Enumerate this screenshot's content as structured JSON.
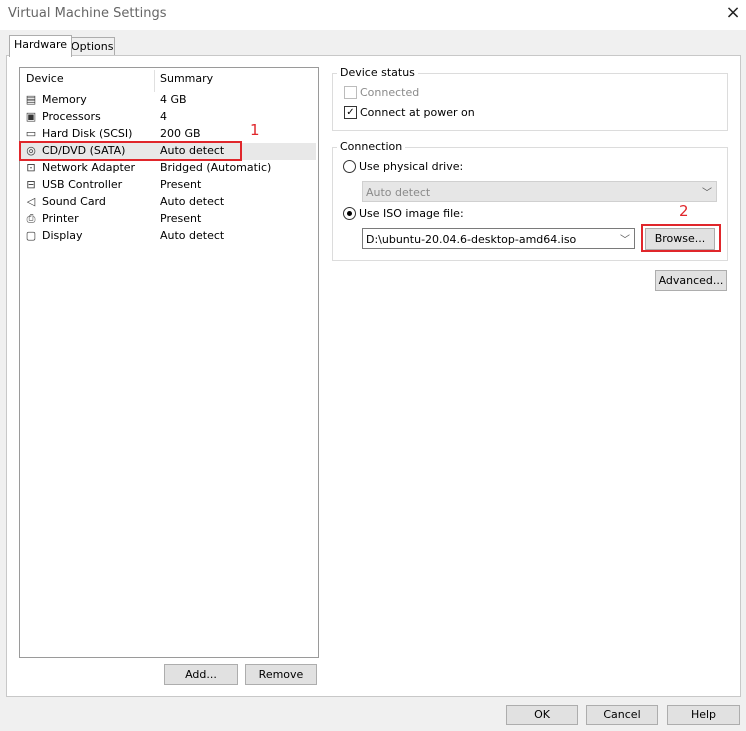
{
  "window": {
    "title": "Virtual Machine Settings",
    "close_icon": "×"
  },
  "tabs": [
    {
      "label": "Hardware",
      "active": true
    },
    {
      "label": "Options",
      "active": false
    }
  ],
  "device_list": {
    "headers": {
      "device": "Device",
      "summary": "Summary"
    },
    "rows": [
      {
        "name": "Memory",
        "summary": "4 GB",
        "icon": "memory-icon"
      },
      {
        "name": "Processors",
        "summary": "4",
        "icon": "processor-icon"
      },
      {
        "name": "Hard Disk (SCSI)",
        "summary": "200 GB",
        "icon": "hard-disk-icon"
      },
      {
        "name": "CD/DVD (SATA)",
        "summary": "Auto detect",
        "icon": "cd-dvd-icon"
      },
      {
        "name": "Network Adapter",
        "summary": "Bridged (Automatic)",
        "icon": "network-adapter-icon"
      },
      {
        "name": "USB Controller",
        "summary": "Present",
        "icon": "usb-icon"
      },
      {
        "name": "Sound Card",
        "summary": "Auto detect",
        "icon": "speaker-icon"
      },
      {
        "name": "Printer",
        "summary": "Present",
        "icon": "printer-icon"
      },
      {
        "name": "Display",
        "summary": "Auto detect",
        "icon": "display-icon"
      }
    ],
    "selected": "CD/DVD (SATA)"
  },
  "annotations": {
    "marker1": "1",
    "marker2": "2",
    "color": "#e0262b"
  },
  "buttons": {
    "add": "Add...",
    "remove": "Remove",
    "ok": "OK",
    "cancel": "Cancel",
    "help": "Help",
    "browse": "Browse...",
    "advanced": "Advanced..."
  },
  "device_status": {
    "label": "Device status",
    "connected": {
      "label": "Connected",
      "checked": false,
      "enabled": false
    },
    "connect_at_power_on": {
      "label": "Connect at power on",
      "checked": true
    }
  },
  "connection": {
    "label": "Connection",
    "physical_drive": {
      "label": "Use physical drive:",
      "selected": false,
      "value": "Auto detect",
      "enabled": false
    },
    "iso_image": {
      "label": "Use ISO image file:",
      "selected": true,
      "value": "D:\\ubuntu-20.04.6-desktop-amd64.iso"
    }
  }
}
